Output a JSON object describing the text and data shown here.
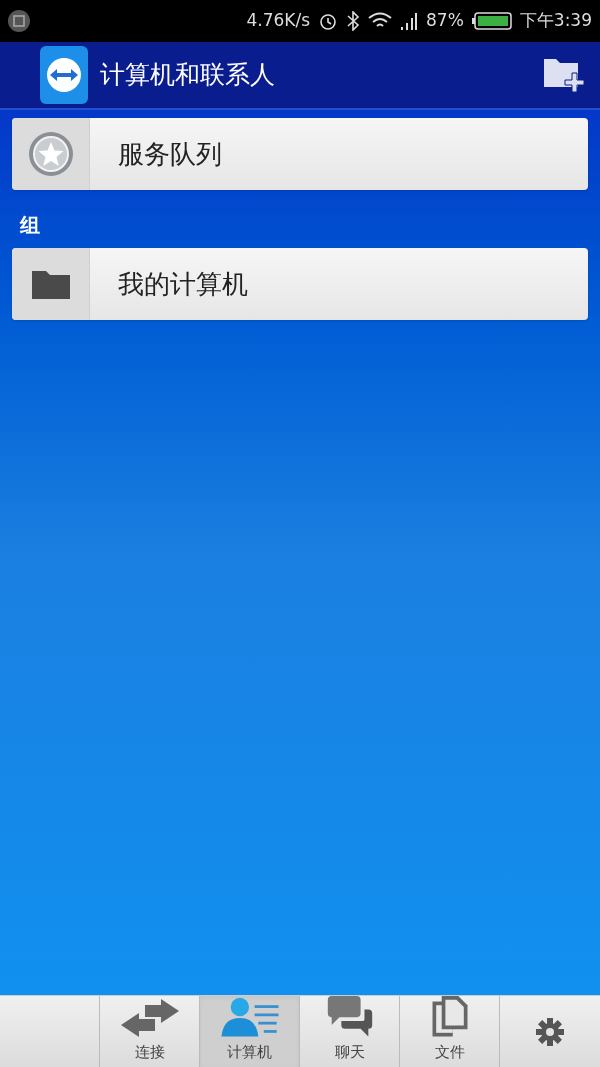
{
  "status_bar": {
    "speed": "4.76K/s",
    "battery": "87%",
    "time": "下午3:39"
  },
  "header": {
    "title": "计算机和联系人"
  },
  "items": [
    {
      "kind": "star",
      "label": "服务队列"
    }
  ],
  "section": {
    "title": "组"
  },
  "groups": [
    {
      "kind": "folder",
      "label": "我的计算机"
    }
  ],
  "tabs": [
    {
      "kind": "arrows",
      "label": "连接",
      "selected": false
    },
    {
      "kind": "contacts",
      "label": "计算机",
      "selected": true
    },
    {
      "kind": "chat",
      "label": "聊天",
      "selected": false
    },
    {
      "kind": "files",
      "label": "文件",
      "selected": false
    }
  ]
}
